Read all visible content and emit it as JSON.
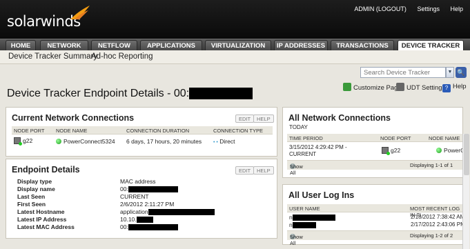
{
  "header": {
    "brand": "solarwinds",
    "links": [
      "ADMIN (LOGOUT)",
      "Settings",
      "Help"
    ]
  },
  "tabs": [
    "HOME",
    "NETWORK",
    "NETFLOW",
    "APPLICATIONS",
    "VIRTUALIZATION",
    "IP ADDRESSES",
    "TRANSACTIONS",
    "DEVICE TRACKER"
  ],
  "active_tab": "DEVICE TRACKER",
  "subnav": [
    "Device Tracker Summary",
    "Ad-hoc Reporting"
  ],
  "search": {
    "placeholder": "Search Device Tracker"
  },
  "actions": {
    "customize": "Customize Page",
    "udt_settings": "UDT Settings",
    "help": "Help"
  },
  "page_title": "Device Tracker Endpoint Details - 00:",
  "current_connections": {
    "title": "Current Network Connections",
    "edit": "EDIT",
    "help": "HELP",
    "columns": [
      "NODE PORT",
      "NODE NAME",
      "CONNECTION DURATION",
      "CONNECTION TYPE"
    ],
    "row": {
      "port": "g22",
      "node": "PowerConnect5324",
      "duration": "6 days, 17 hours, 20 minutes",
      "type": "Direct"
    }
  },
  "endpoint_details": {
    "title": "Endpoint Details",
    "edit": "EDIT",
    "help": "HELP",
    "rows": [
      {
        "label": "Display type",
        "value": "MAC address"
      },
      {
        "label": "Display name",
        "value": "00:"
      },
      {
        "label": "Last Seen",
        "value": "CURRENT"
      },
      {
        "label": "First Seen",
        "value": "2/6/2012 2:11:27 PM"
      },
      {
        "label": "Latest Hostname",
        "value": "application"
      },
      {
        "label": "Latest IP Address",
        "value": "10.10."
      },
      {
        "label": "Latest MAC Address",
        "value": "00:"
      }
    ]
  },
  "all_connections": {
    "title": "All Network Connections",
    "subtitle": "TODAY",
    "columns": [
      "TIME PERIOD",
      "NODE PORT",
      "NODE NAME"
    ],
    "row": {
      "time_line1": "3/15/2012 4:29:42 PM -",
      "time_line2": "CURRENT",
      "port": "g22",
      "node": "PowerCo"
    },
    "show_all": "Show All",
    "paging": "Displaying 1-1 of 1"
  },
  "user_logins": {
    "title": "All User Log Ins",
    "columns": [
      "USER NAME",
      "MOST RECENT LOG IN TI"
    ],
    "rows": [
      {
        "user_prefix": "n",
        "time": "2/18/2012 7:38:42 AM"
      },
      {
        "user_prefix": "n",
        "time": "2/17/2012 2:43:06 PM"
      }
    ],
    "show_all": "Show All",
    "paging": "Displaying 1-2 of 2"
  },
  "colors": {
    "brand_orange": "#f39c12",
    "active_tab": "#ffffff",
    "status_green": "#1a9a1a"
  }
}
